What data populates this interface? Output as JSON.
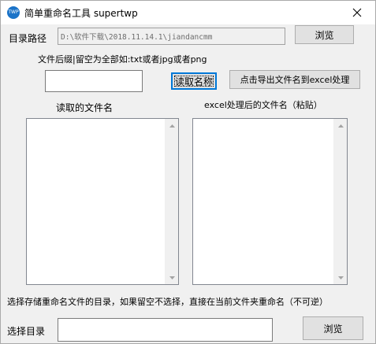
{
  "window": {
    "title": "简单重命名工具 supertwp",
    "icon_text": "TWP"
  },
  "dir_row": {
    "label": "目录路径",
    "path_value": "D:\\软件下载\\2018.11.14.1\\jiandancmm",
    "browse_label": "浏览"
  },
  "suffix_row": {
    "label": "文件后缀|留空为全部如:txt或者jpg或者png",
    "input_value": "",
    "read_button": "读取名称",
    "export_button": "点击导出文件名到excel处理"
  },
  "lists": {
    "left_header": "读取的文件名",
    "right_header": "excel处理后的文件名（粘贴）"
  },
  "save_row": {
    "hint": "选择存储重命名文件的目录，如果留空不选择，直接在当前文件夹重命名（不可逆）",
    "label": "选择目录",
    "input_value": "",
    "browse_label": "浏览"
  }
}
